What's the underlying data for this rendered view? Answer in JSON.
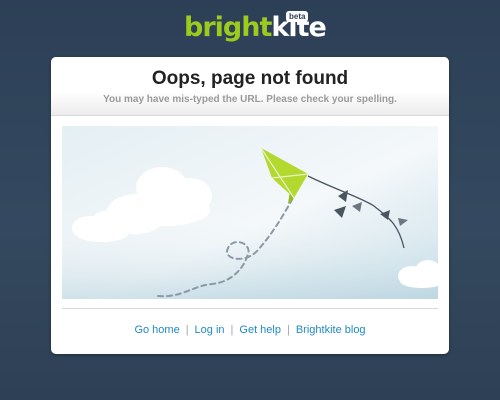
{
  "brand": {
    "name_part1": "bright",
    "name_part2": "kite",
    "badge": "beta"
  },
  "error": {
    "title": "Oops, page not found",
    "message": "You may have mis-typed the URL. Please check your spelling."
  },
  "illustration": {
    "icons": [
      "cloud-icon",
      "kite-icon",
      "kite-tail-icon"
    ]
  },
  "footer": {
    "links": [
      {
        "label": "Go home"
      },
      {
        "label": "Log in"
      },
      {
        "label": "Get help"
      },
      {
        "label": "Brightkite blog"
      }
    ],
    "separator": "|"
  },
  "colors": {
    "background": "#2c3f56",
    "brand_green": "#9ccb1e",
    "link_blue": "#1f8ac4",
    "sky": "#c9dfe8"
  }
}
